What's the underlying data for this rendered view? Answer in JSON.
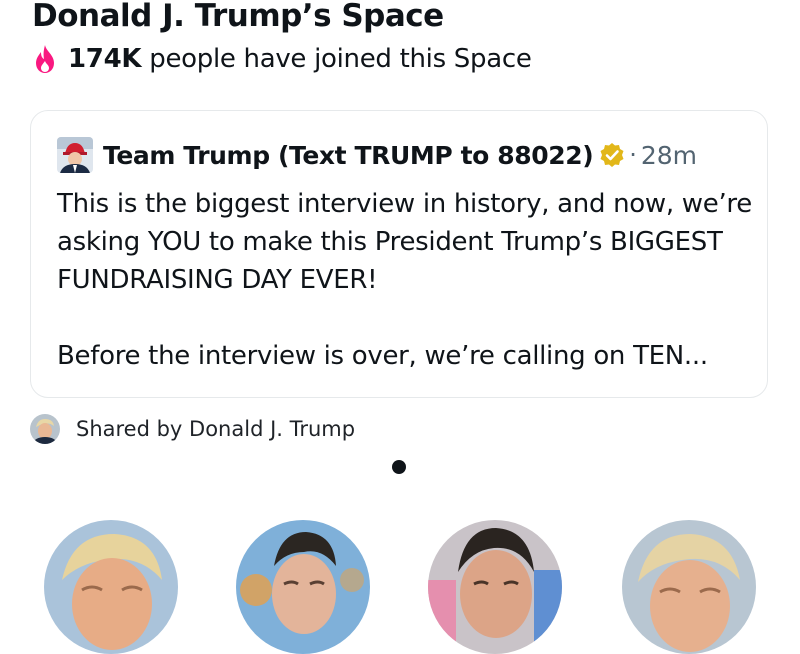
{
  "space": {
    "title": "Donald J. Trump’s Space",
    "joined_count": "174K",
    "joined_text": "people have joined this Space"
  },
  "post": {
    "author": "Team Trump (Text TRUMP to 88022)",
    "separator": "·",
    "time": "28m",
    "paragraph1": "This is the biggest interview in history, and now, we’re asking YOU to make this President Trump’s BIGGEST FUNDRAISING DAY EVER!",
    "paragraph2": "Before the interview is over, we’re calling on TEN..."
  },
  "shared_by": "Shared by Donald J. Trump",
  "icons": {
    "flame": "flame-icon",
    "verified": "verified-badge-icon"
  },
  "colors": {
    "flame": "#f91880",
    "verified_badge": "#e2b719",
    "text_primary": "#0f1419",
    "text_secondary": "#536471"
  },
  "carousel": {
    "page_count": 1,
    "active_page": 1
  },
  "speakers_visible": 4
}
